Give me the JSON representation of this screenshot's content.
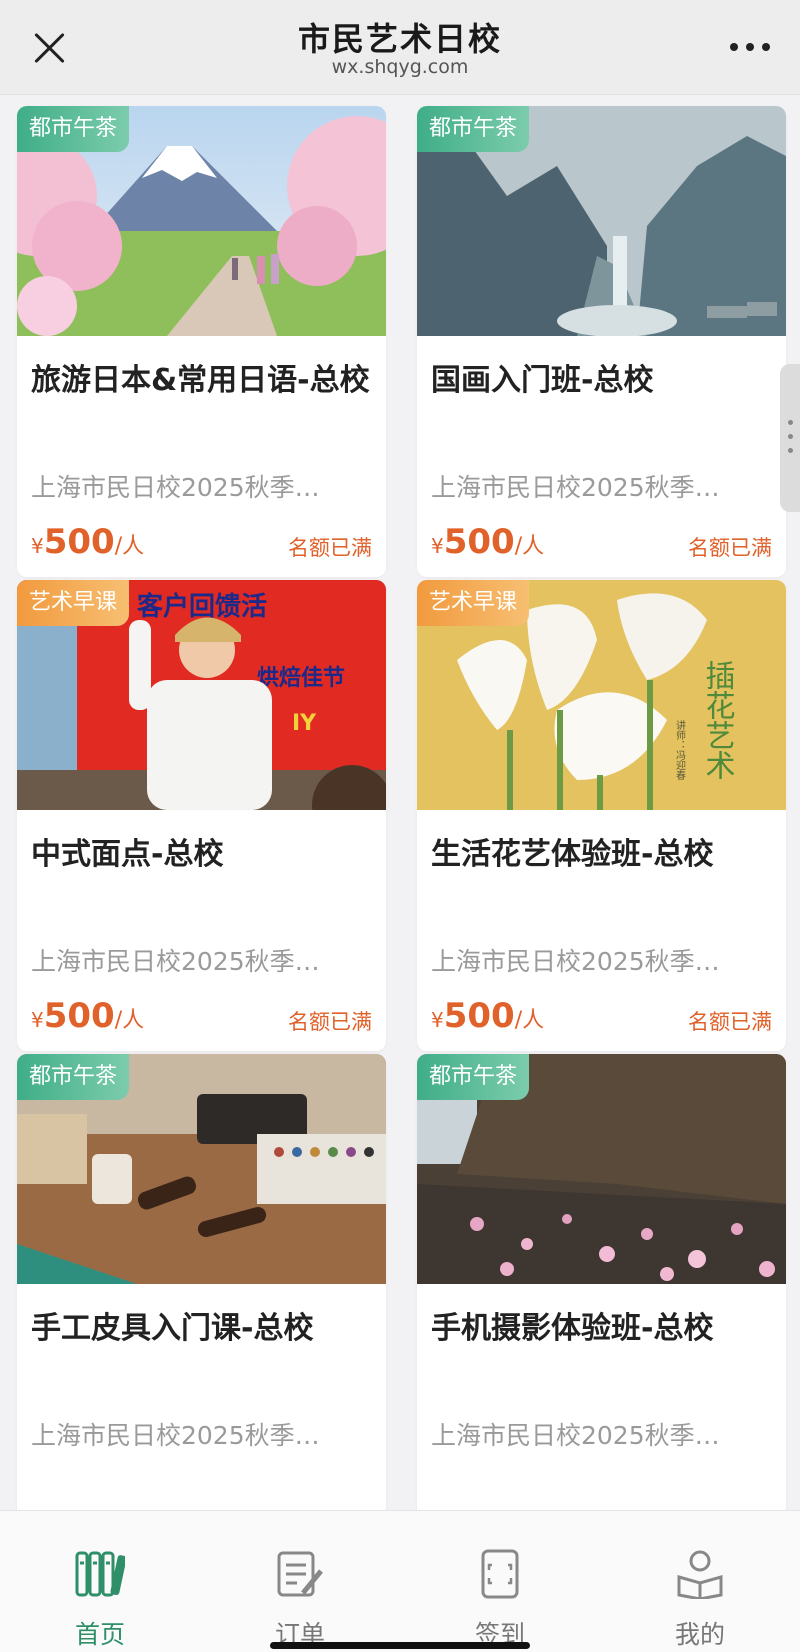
{
  "header": {
    "title": "市民艺术日校",
    "url": "wx.shqyg.com"
  },
  "cards": [
    {
      "tag": "都市午茶",
      "tag_color": "#4db894",
      "title": "旅游日本&常用日语-总校",
      "subtitle": "上海市民日校2025秋季…",
      "currency": "¥",
      "price": "500",
      "unit": "/人",
      "status": "名额已满"
    },
    {
      "tag": "都市午茶",
      "tag_color": "#4db894",
      "title": "国画入门班-总校",
      "subtitle": "上海市民日校2025秋季…",
      "currency": "¥",
      "price": "500",
      "unit": "/人",
      "status": "名额已满"
    },
    {
      "tag": "艺术早课",
      "tag_color": "#f4a24b",
      "title": "中式面点-总校",
      "subtitle": "上海市民日校2025秋季…",
      "currency": "¥",
      "price": "500",
      "unit": "/人",
      "status": "名额已满"
    },
    {
      "tag": "艺术早课",
      "tag_color": "#f4a24b",
      "title": "生活花艺体验班-总校",
      "subtitle": "上海市民日校2025秋季…",
      "currency": "¥",
      "price": "500",
      "unit": "/人",
      "status": "名额已满"
    },
    {
      "tag": "都市午茶",
      "tag_color": "#4db894",
      "title": "手工皮具入门课-总校",
      "subtitle": "上海市民日校2025秋季…"
    },
    {
      "tag": "都市午茶",
      "tag_color": "#4db894",
      "title": "手机摄影体验班-总校",
      "subtitle": "上海市民日校2025秋季…"
    }
  ],
  "photo_text": {
    "vase_calligraphy": "插花艺术",
    "vase_signature": "讲师：冯迎春",
    "banner_line1": "客户回馈活",
    "banner_line2": "烘焙佳节",
    "banner_line3": "IY"
  },
  "tabbar": [
    {
      "label": "首页",
      "icon": "home-books-icon",
      "active": true
    },
    {
      "label": "订单",
      "icon": "order-edit-icon",
      "active": false
    },
    {
      "label": "签到",
      "icon": "scan-phone-icon",
      "active": false
    },
    {
      "label": "我的",
      "icon": "user-reading-icon",
      "active": false
    }
  ],
  "colors": {
    "accent_green": "#2e8f68",
    "price_orange": "#e0612a",
    "tag_green": "#4db894",
    "tag_orange": "#f4a24b"
  }
}
